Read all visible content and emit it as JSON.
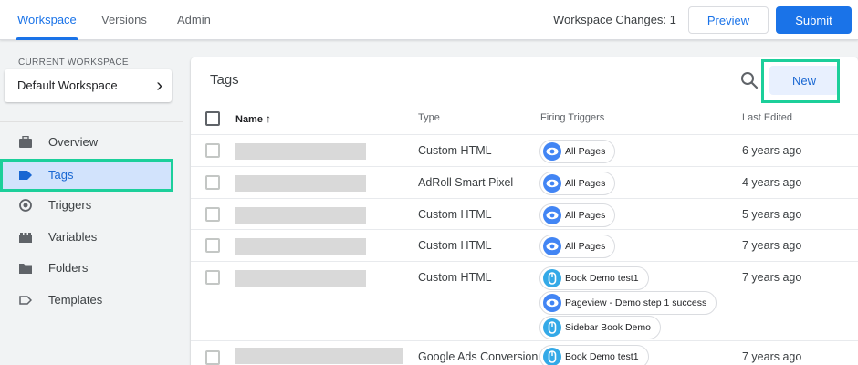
{
  "topbar": {
    "tabs": [
      "Workspace",
      "Versions",
      "Admin"
    ],
    "changes_label": "Workspace Changes: 1",
    "preview_label": "Preview",
    "submit_label": "Submit"
  },
  "sidebar": {
    "workspace_heading": "CURRENT WORKSPACE",
    "workspace_name": "Default Workspace",
    "items": [
      {
        "label": "Overview",
        "icon": "briefcase-icon"
      },
      {
        "label": "Tags",
        "icon": "tag-icon",
        "active": true
      },
      {
        "label": "Triggers",
        "icon": "trigger-icon"
      },
      {
        "label": "Variables",
        "icon": "variables-icon"
      },
      {
        "label": "Folders",
        "icon": "folder-icon"
      },
      {
        "label": "Templates",
        "icon": "template-icon"
      }
    ]
  },
  "main": {
    "title": "Tags",
    "new_label": "New",
    "columns": {
      "name": "Name",
      "sort_arrow": "↑",
      "type": "Type",
      "triggers": "Firing Triggers",
      "edited": "Last Edited"
    },
    "rows": [
      {
        "type": "Custom HTML",
        "triggers": [
          "All Pages"
        ],
        "trigger_icons": [
          "pageview-icon"
        ],
        "edited": "6 years ago"
      },
      {
        "type": "AdRoll Smart Pixel",
        "triggers": [
          "All Pages"
        ],
        "trigger_icons": [
          "pageview-icon"
        ],
        "edited": "4 years ago"
      },
      {
        "type": "Custom HTML",
        "triggers": [
          "All Pages"
        ],
        "trigger_icons": [
          "pageview-icon"
        ],
        "edited": "5 years ago"
      },
      {
        "type": "Custom HTML",
        "triggers": [
          "All Pages"
        ],
        "trigger_icons": [
          "pageview-icon"
        ],
        "edited": "7 years ago"
      },
      {
        "type": "Custom HTML",
        "triggers": [
          "Book Demo test1",
          "Pageview - Demo step 1 success",
          "Sidebar Book Demo"
        ],
        "trigger_icons": [
          "click-icon",
          "pageview-icon",
          "click-icon"
        ],
        "edited": "7 years ago"
      },
      {
        "type": "Google Ads Conversion",
        "triggers": [
          "Book Demo test1"
        ],
        "trigger_icons": [
          "click-icon"
        ],
        "edited": "7 years ago"
      }
    ]
  },
  "colors": {
    "accent": "#1a73e8",
    "highlight": "#1ccf9a",
    "active_nav_bg": "#d2e3fc"
  }
}
